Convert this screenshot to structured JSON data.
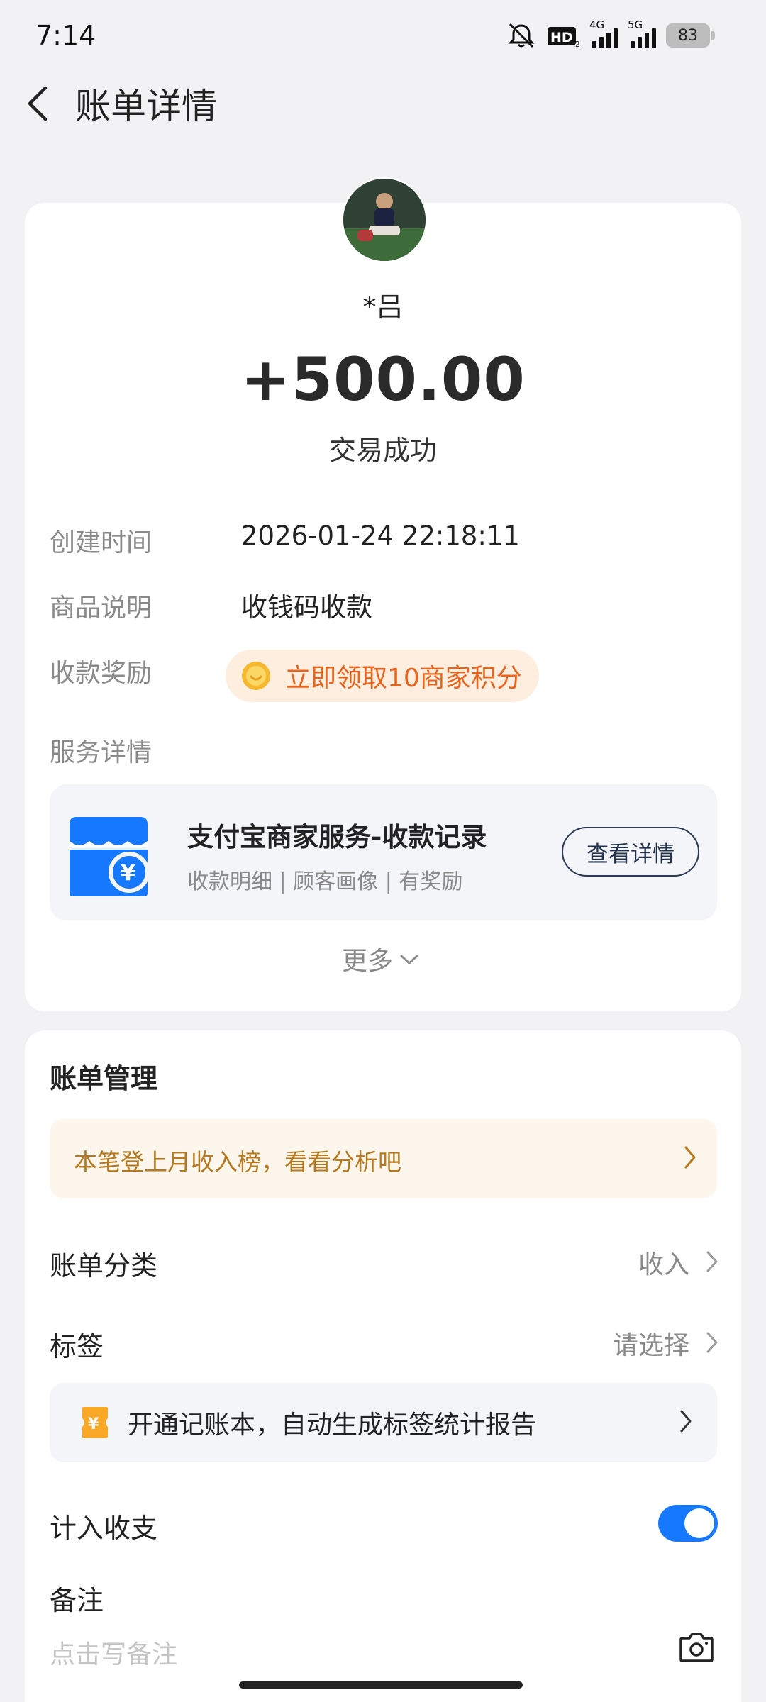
{
  "status_bar": {
    "time": "7:14",
    "hd_label": "HD",
    "net1_label": "4G",
    "net2_label": "5G",
    "battery": "83"
  },
  "header": {
    "title": "账单详情"
  },
  "transaction": {
    "payer_name": "*吕",
    "amount": "+500.00",
    "status": "交易成功"
  },
  "details": {
    "created_label": "创建时间",
    "created_value": "2026-01-24 22:18:11",
    "product_label": "商品说明",
    "product_value": "收钱码收款",
    "reward_label": "收款奖励",
    "reward_value": "立即领取10商家积分",
    "service_label": "服务详情"
  },
  "service": {
    "title": "支付宝商家服务-收款记录",
    "subtitle": "收款明细 | 顾客画像 | 有奖励",
    "button_label": "查看详情"
  },
  "more_label": "更多",
  "management": {
    "title": "账单管理",
    "rank_banner": "本笔登上月收入榜，看看分析吧",
    "category_label": "账单分类",
    "category_value": "收入",
    "tag_label": "标签",
    "tag_value": "请选择",
    "ledger_banner": "开通记账本，自动生成标签统计报告",
    "include_label": "计入收支",
    "include_on": true,
    "note_label": "备注",
    "note_placeholder": "点击写备注"
  },
  "colors": {
    "accent": "#1677ff",
    "reward_text": "#e8651e",
    "rank_text": "#b7791f",
    "background": "#f2f2f4"
  }
}
